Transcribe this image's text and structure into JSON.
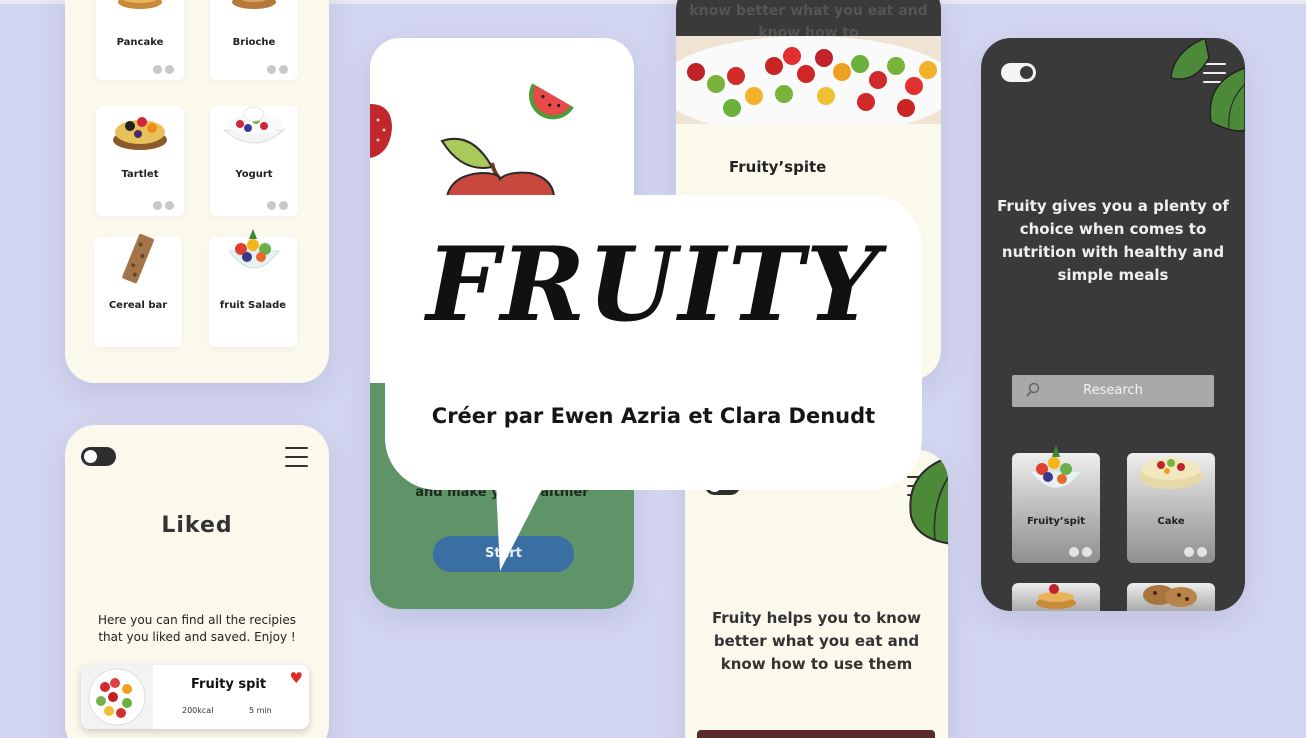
{
  "brand": {
    "logo_text": "FRUITY",
    "credit": "Créer par Ewen Azria et Clara Denudt"
  },
  "snacks_screen": {
    "items": [
      {
        "label": "Pancake"
      },
      {
        "label": "Brioche"
      },
      {
        "label": "Tartlet"
      },
      {
        "label": "Yogurt"
      },
      {
        "label": "Cereal bar"
      },
      {
        "label": "fruit Salade"
      }
    ]
  },
  "liked_screen": {
    "title": "Liked",
    "description": "Here you can find all the recipies that you liked and saved. Enjoy !",
    "card": {
      "title": "Fruity spit",
      "kcal": "200kcal",
      "time": "5 min"
    }
  },
  "splash_screen": {
    "tagline": "and make you healthier",
    "start_label": "Start"
  },
  "skewer_screen": {
    "header_text": "know better what you eat and know how to",
    "title": "Fruity’spite"
  },
  "info_screen": {
    "text": "Fruity helps you to know better what you eat and know how to use them"
  },
  "dark_screen": {
    "text": "Fruity gives you a plenty of choice when comes to nutrition with healthy and simple meals",
    "search_placeholder": "Research",
    "cards": [
      {
        "label": "Fruity’spit"
      },
      {
        "label": "Cake"
      }
    ]
  },
  "colors": {
    "background": "#d3d6f0",
    "cream": "#fbf9ec",
    "green": "#5f9468",
    "button_blue": "#3a6fa4",
    "dark": "#3a3a3a",
    "heart": "#e02a2a"
  }
}
